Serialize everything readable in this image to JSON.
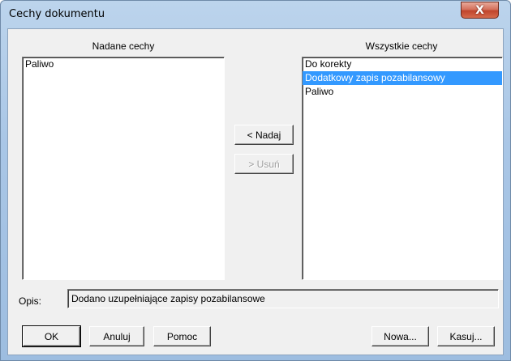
{
  "window": {
    "title": "Cechy dokumentu",
    "close_symbol": "X"
  },
  "assigned": {
    "header": "Nadane cechy",
    "items": [
      "Paliwo"
    ]
  },
  "all": {
    "header": "Wszystkie cechy",
    "items": [
      "Do korekty",
      "Dodatkowy zapis pozabilansowy",
      "Paliwo"
    ],
    "selected_index": 1
  },
  "actions": {
    "assign_label": "< Nadaj",
    "remove_label": "> Usuń"
  },
  "description": {
    "label": "Opis:",
    "value": "Dodano uzupełniające zapisy pozabilansowe"
  },
  "footer": {
    "ok_label": "OK",
    "cancel_label": "Anuluj",
    "help_label": "Pomoc",
    "new_label": "Nowa...",
    "delete_label": "Kasuj..."
  }
}
